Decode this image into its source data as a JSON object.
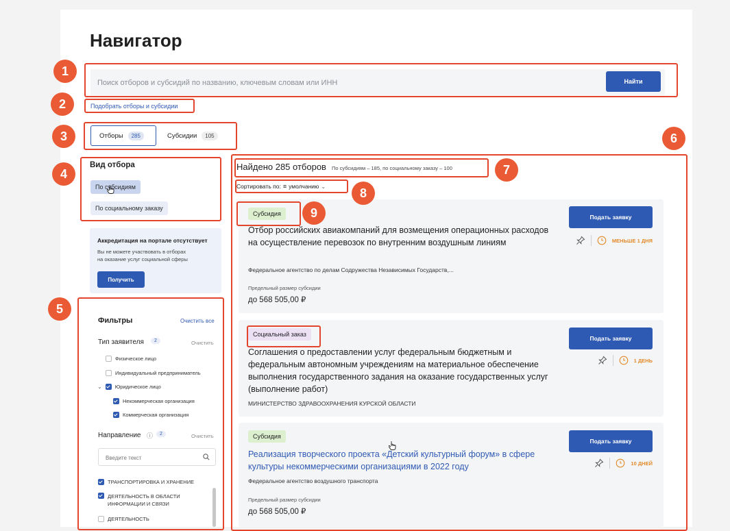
{
  "page": {
    "title": "Навигатор"
  },
  "search": {
    "placeholder": "Поиск отборов и субсидий по названию, ключевым словам или ИНН",
    "button": "Найти"
  },
  "picker_link": "Подобрать отборы и субсидии",
  "tabs": [
    {
      "label": "Отборы",
      "count": "285",
      "active": true
    },
    {
      "label": "Субсидии",
      "count": "105",
      "active": false
    }
  ],
  "selection_type": {
    "heading": "Вид отбора",
    "options": [
      "По субсидиям",
      "По социальному заказу"
    ]
  },
  "promo": {
    "title": "Аккредитация на портале отсутствует",
    "text_line1": "Вы не можете участвовать в отборах",
    "text_line2": "на оказание услуг социальной сферы",
    "button": "Получить"
  },
  "filters": {
    "title": "Фильтры",
    "clear_all": "Очистить все",
    "applicant": {
      "label": "Тип заявителя",
      "count": "2",
      "clear": "Очистить",
      "items": [
        {
          "label": "Физическое лицо",
          "checked": false
        },
        {
          "label": "Индивидуальный предприниматель",
          "checked": false
        },
        {
          "label": "Юридическое лицо",
          "checked": true
        },
        {
          "label": "Некоммерческая организация",
          "checked": true
        },
        {
          "label": "Коммерческая организация",
          "checked": true
        }
      ]
    },
    "direction": {
      "label": "Направление",
      "count": "2",
      "clear": "Очистить",
      "search_placeholder": "Введите текст",
      "items": [
        {
          "label": "ТРАНСПОРТИРОВКА И ХРАНЕНИЕ",
          "checked": true
        },
        {
          "label": "ДЕЯТЕЛЬНОСТЬ В ОБЛАСТИ",
          "label2": "ИНФОРМАЦИИ И СВЯЗИ",
          "checked": true
        },
        {
          "label": "ДЕЯТЕЛЬНОСТЬ",
          "checked": false
        }
      ]
    }
  },
  "results": {
    "found": "Найдено 285 отборов",
    "breakdown": "По субсидиям – 185, по социальному заказу – 100",
    "sort_label": "Сортировать по:",
    "sort_value": "умолчанию"
  },
  "cards": [
    {
      "tag": "Субсидия",
      "title": "Отбор российских авиакомпаний для возмещения операционных расходов на осуществление перевозок по внутренним воздушным линиям",
      "org": "Федеральное агентство по делам Содружества Независимых Государств,...",
      "amount_label": "Предельный размер субсидии",
      "amount": "до 568 505,00 ₽",
      "button": "Подать заявку",
      "deadline": "МЕНЬШЕ 1 ДНЯ"
    },
    {
      "tag": "Социальный заказ",
      "title": "Соглашения о предоставлении услуг федеральным бюджетным и федеральным автономным учреждениям на материальное обеспечение выполнения государственного задания на оказание государственных услуг (выполнение работ)",
      "org": "МИНИСТЕРСТВО ЗДРАВООХРАНЕНИЯ КУРСКОЙ ОБЛАСТИ",
      "button": "Подать заявку",
      "deadline": "1 ДЕНЬ"
    },
    {
      "tag": "Субсидия",
      "title": "Реализация творческого проекта «Детский культурный форум» в сфере культуры некоммерческими организациями в 2022 году",
      "org": "Федеральное агентство воздушного транспорта",
      "amount_label": "Предельный размер субсидии",
      "amount": "до 568 505,00 ₽",
      "button": "Подать заявку",
      "deadline": "10 ДНЕЙ"
    }
  ],
  "annotations": [
    "1",
    "2",
    "3",
    "4",
    "5",
    "6",
    "7",
    "8",
    "9"
  ],
  "colors": {
    "accent": "#2f5ab3",
    "annotation": "#e2452c",
    "deadline": "#e38a2a"
  }
}
